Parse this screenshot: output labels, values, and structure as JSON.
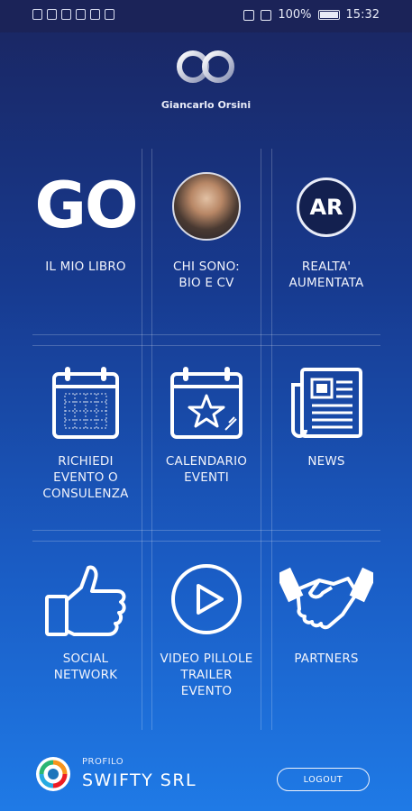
{
  "status_bar": {
    "battery": "100%",
    "time": "15:32"
  },
  "header": {
    "logo_icon": "go-infinity-logo",
    "name": "Giancarlo Orsini"
  },
  "grid": [
    {
      "id": "libro",
      "label": "IL MIO LIBRO",
      "icon": "go-text",
      "icon_text": "GO"
    },
    {
      "id": "bio",
      "label": "CHI SONO:\nBIO E CV",
      "icon": "avatar"
    },
    {
      "id": "ar",
      "label": "REALTA'\nAUMENTATA",
      "icon": "ar-badge-icon",
      "icon_text": "AR"
    },
    {
      "id": "richiedi",
      "label": "RICHIEDI\nEVENTO O\nCONSULENZA",
      "icon": "calendar-grid-icon"
    },
    {
      "id": "calendario",
      "label": "CALENDARIO\nEVENTI",
      "icon": "calendar-star-icon"
    },
    {
      "id": "news",
      "label": "NEWS",
      "icon": "newspaper-icon"
    },
    {
      "id": "social",
      "label": "SOCIAL\nNETWORK",
      "icon": "thumbs-up-icon"
    },
    {
      "id": "video",
      "label": "VIDEO PILLOLE\nTRAILER\nEVENTO",
      "icon": "play-circle-icon"
    },
    {
      "id": "partners",
      "label": "PARTNERS",
      "icon": "handshake-icon"
    }
  ],
  "footer": {
    "profile_caption": "PROFILO",
    "profile_name": "SWIFTY SRL",
    "logout_label": "LOGOUT"
  }
}
